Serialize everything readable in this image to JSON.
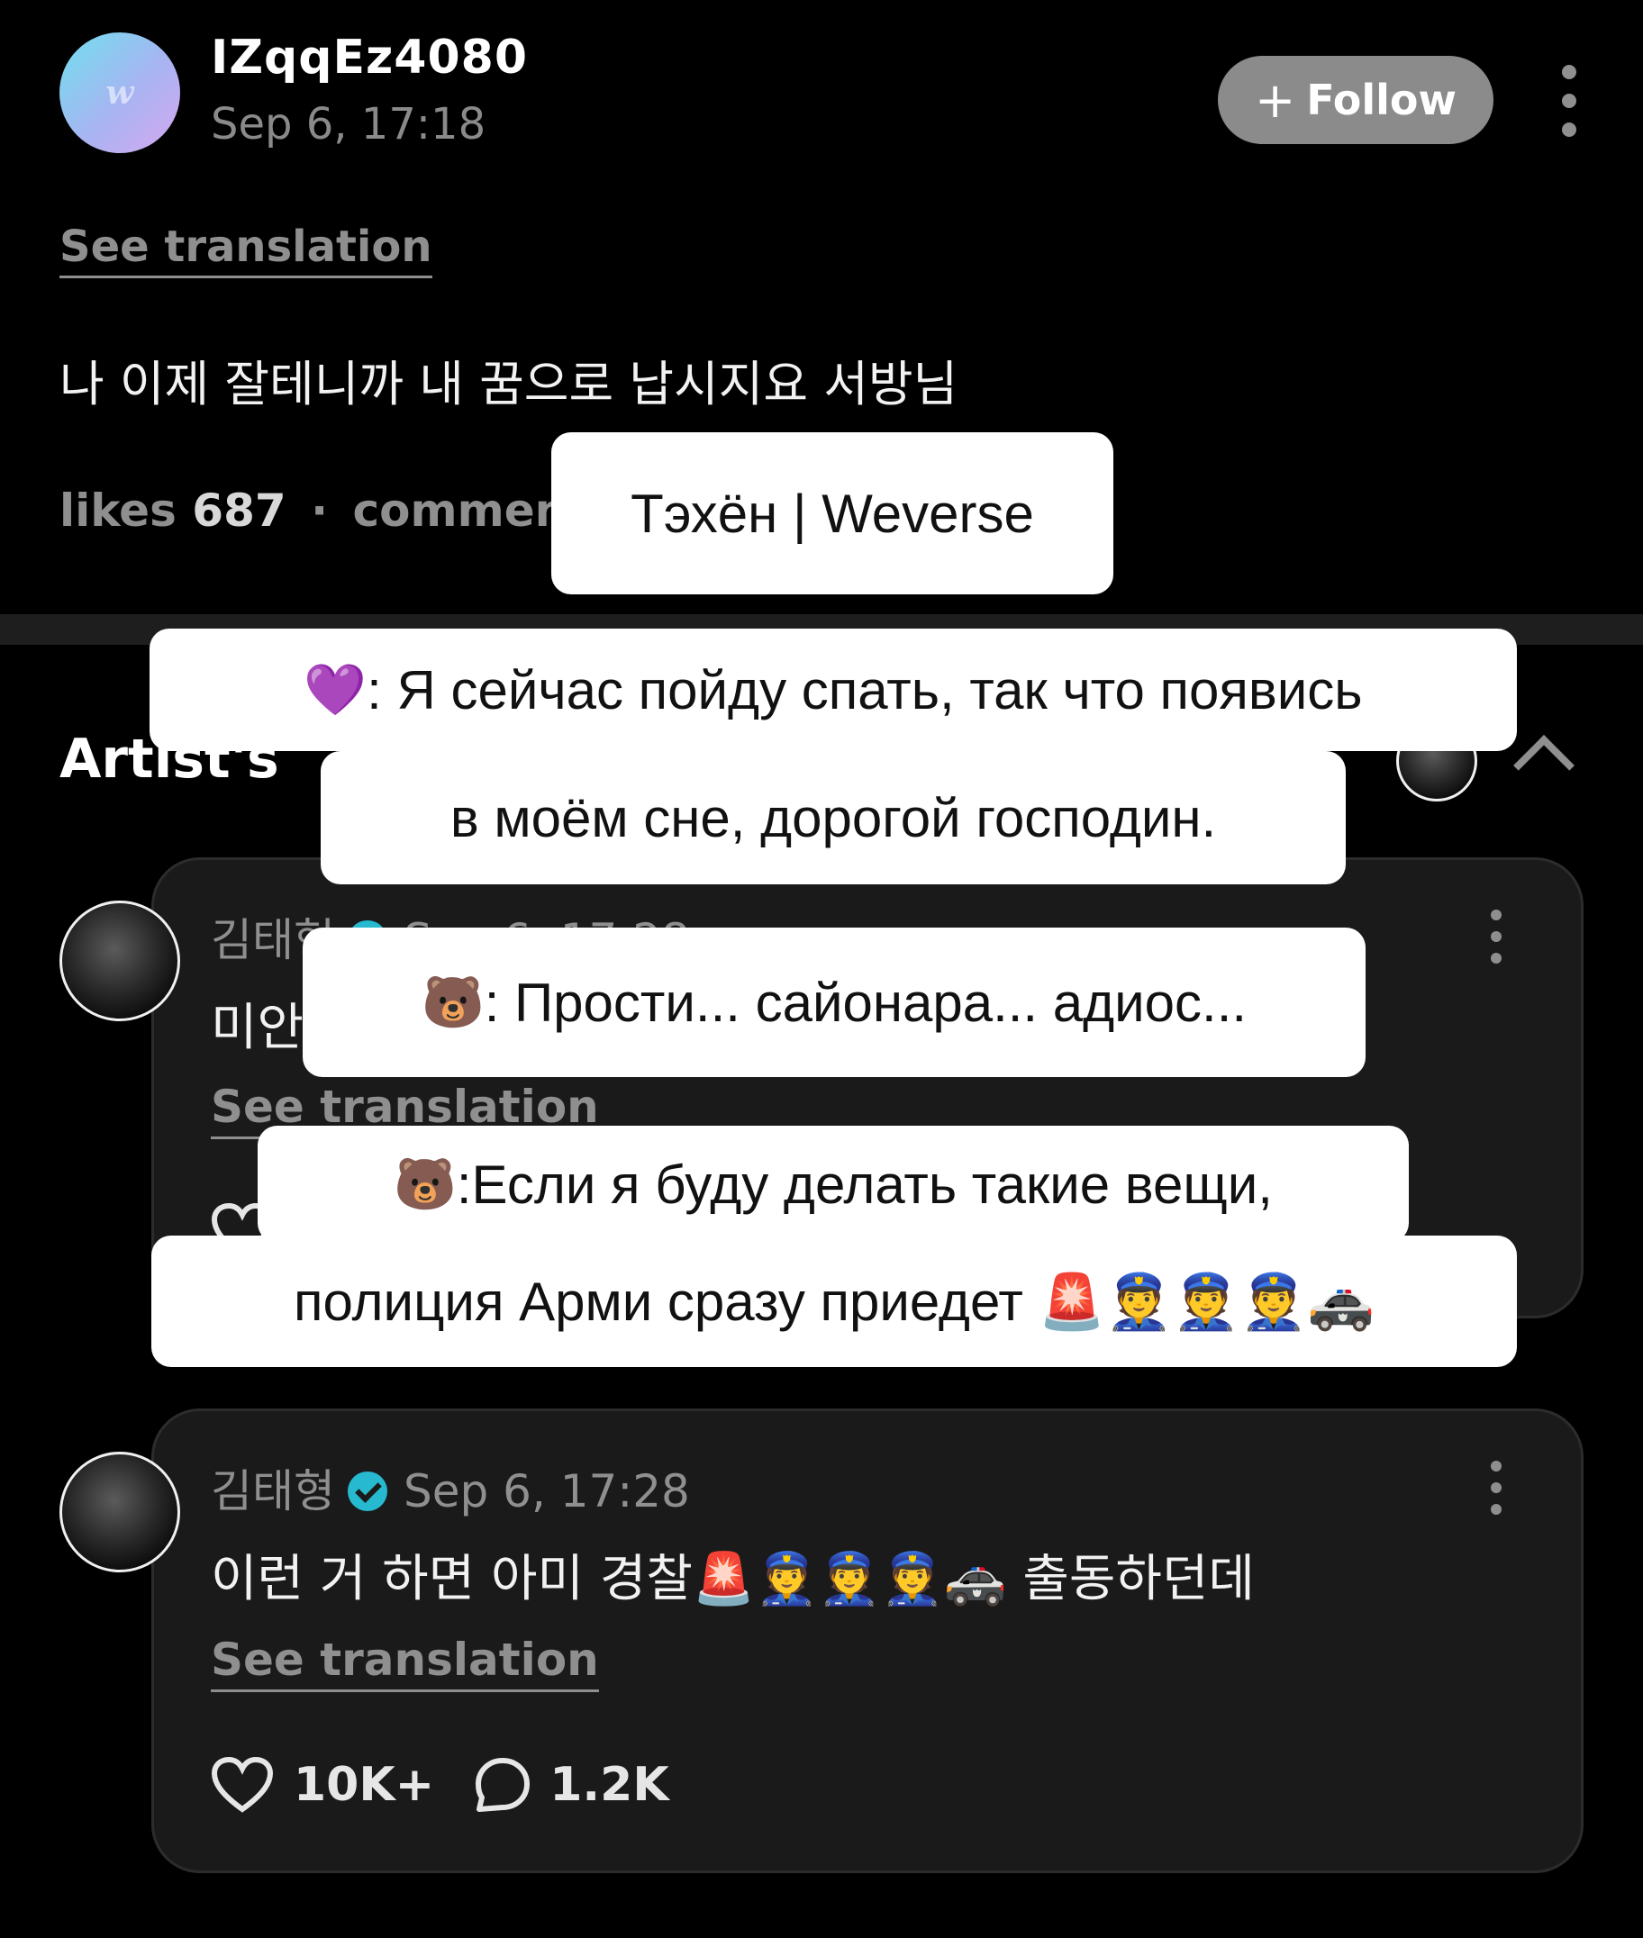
{
  "post": {
    "avatar_letter": "w",
    "username": "IZqqEz4080",
    "date": "Sep 6, 17:18",
    "follow_label": "Follow",
    "see_translation": "See translation",
    "text": "나 이제 잘테니까 내 꿈으로 납시지요 서방님",
    "likes_label": "likes",
    "likes_count": "687",
    "separator": "·",
    "comments_label": "comment"
  },
  "section": {
    "title": "Artist's"
  },
  "comments": [
    {
      "author": "김태형",
      "date": "Sep 6, 17:28",
      "text": "미안",
      "see_translation": "See translation"
    },
    {
      "author": "김태형",
      "date": "Sep 6, 17:28",
      "text": "이런 거 하면 아미 경찰🚨👮👮👮🚓 출동하던데",
      "see_translation": "See translation",
      "likes": "10K+",
      "comments": "1.2K"
    }
  ],
  "captions": {
    "title": "Тэхён | Weverse",
    "line1_emoji": "💜",
    "line1": ": Я сейчас пойду спать, так что появись",
    "line2": "в моём сне, дорогой господин.",
    "line3_emoji": "🐻",
    "line3": ": Прости... сайонара... адиос...",
    "line4_emoji": "🐻",
    "line4": ":Если я буду делать такие вещи,",
    "line5": "полиция Арми сразу приедет 🚨👮👮👮🚓"
  },
  "colors": {
    "background": "#000000",
    "card": "#1a1a1a",
    "muted_text": "#8f8f8f",
    "verified": "#27b9cf",
    "follow_button": "#8b8b8b"
  },
  "icons": [
    "more-vertical-icon",
    "plus-icon",
    "verified-badge-icon",
    "heart-icon",
    "comment-bubble-icon",
    "chevron-up-icon"
  ]
}
